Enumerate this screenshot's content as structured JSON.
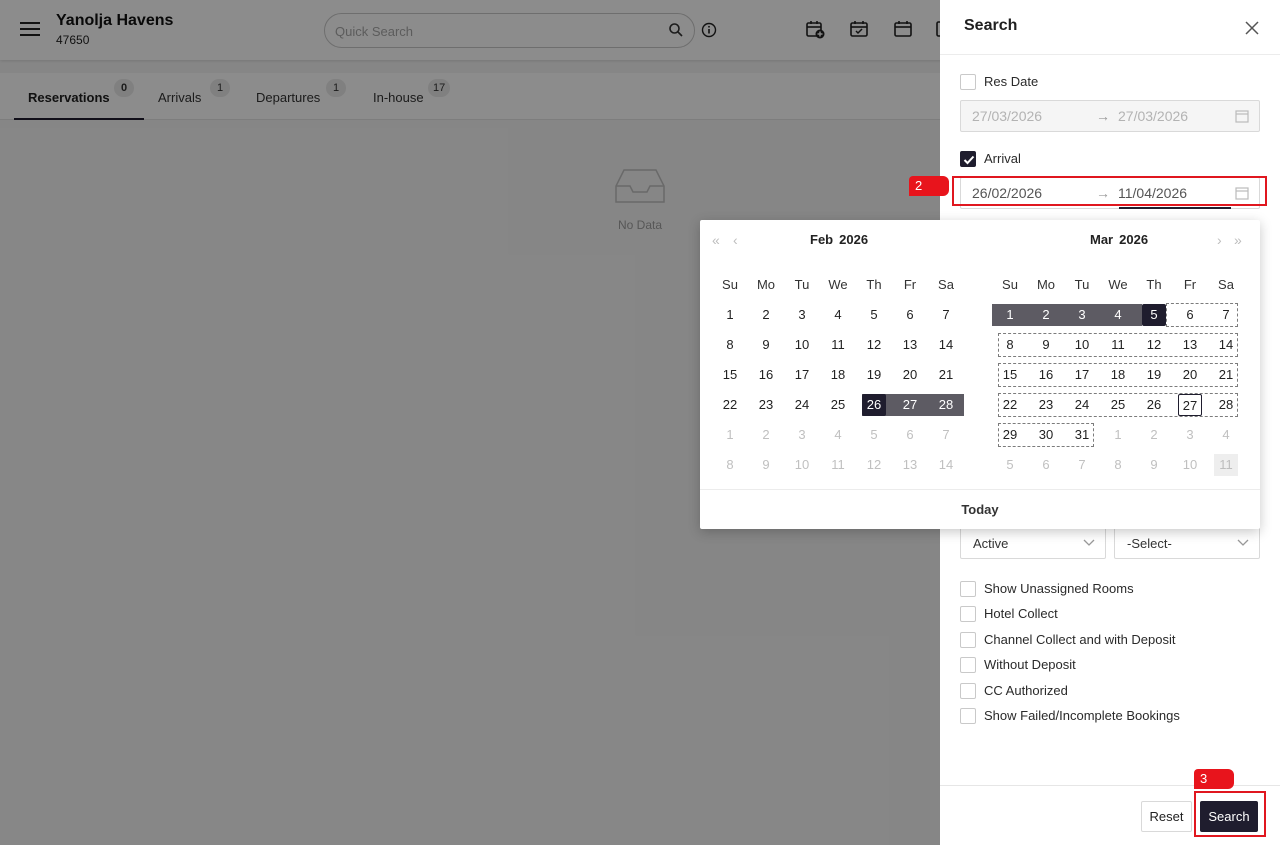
{
  "header": {
    "hotel_name": "Yanolja Havens",
    "hotel_id": "47650",
    "search_placeholder": "Quick Search"
  },
  "tabs": [
    {
      "label": "Reservations",
      "count": "0",
      "active": true
    },
    {
      "label": "Arrivals",
      "count": "1"
    },
    {
      "label": "Departures",
      "count": "1"
    },
    {
      "label": "In-house",
      "count": "17"
    }
  ],
  "empty_state": {
    "text": "No Data"
  },
  "drawer": {
    "title": "Search",
    "res_date": {
      "label": "Res Date",
      "checked": false,
      "start": "27/03/2026",
      "end": "27/03/2026"
    },
    "arrival": {
      "label": "Arrival",
      "checked": true,
      "start": "26/02/2026",
      "end": "11/04/2026"
    },
    "status_select": "Active",
    "second_select": "-Select-",
    "checkboxes": [
      {
        "label": "Show Unassigned Rooms",
        "checked": false
      },
      {
        "label": "Hotel Collect",
        "checked": false
      },
      {
        "label": "Channel Collect and with Deposit",
        "checked": false
      },
      {
        "label": "Without Deposit",
        "checked": false
      },
      {
        "label": "CC Authorized",
        "checked": false
      },
      {
        "label": "Show Failed/Incomplete Bookings",
        "checked": false
      }
    ],
    "reset_label": "Reset",
    "search_label": "Search"
  },
  "calendar": {
    "weekdays": [
      "Su",
      "Mo",
      "Tu",
      "We",
      "Th",
      "Fr",
      "Sa"
    ],
    "left": {
      "month": "Feb",
      "year": "2026",
      "days": [
        [
          "1",
          "2",
          "3",
          "4",
          "5",
          "6",
          "7"
        ],
        [
          "8",
          "9",
          "10",
          "11",
          "12",
          "13",
          "14"
        ],
        [
          "15",
          "16",
          "17",
          "18",
          "19",
          "20",
          "21"
        ],
        [
          "22",
          "23",
          "24",
          "25",
          "26",
          "27",
          "28"
        ],
        [
          "1",
          "2",
          "3",
          "4",
          "5",
          "6",
          "7"
        ],
        [
          "8",
          "9",
          "10",
          "11",
          "12",
          "13",
          "14"
        ]
      ]
    },
    "right": {
      "month": "Mar",
      "year": "2026",
      "days": [
        [
          "1",
          "2",
          "3",
          "4",
          "5",
          "6",
          "7"
        ],
        [
          "8",
          "9",
          "10",
          "11",
          "12",
          "13",
          "14"
        ],
        [
          "15",
          "16",
          "17",
          "18",
          "19",
          "20",
          "21"
        ],
        [
          "22",
          "23",
          "24",
          "25",
          "26",
          "27",
          "28"
        ],
        [
          "29",
          "30",
          "31",
          "1",
          "2",
          "3",
          "4"
        ],
        [
          "5",
          "6",
          "7",
          "8",
          "9",
          "10",
          "11"
        ]
      ]
    },
    "today_label": "Today"
  },
  "annotations": [
    {
      "label": "2"
    },
    {
      "label": "3"
    }
  ],
  "colors": {
    "primary": "#1f1d2e",
    "range": "#5d5b63",
    "annotation": "#e0171f"
  }
}
